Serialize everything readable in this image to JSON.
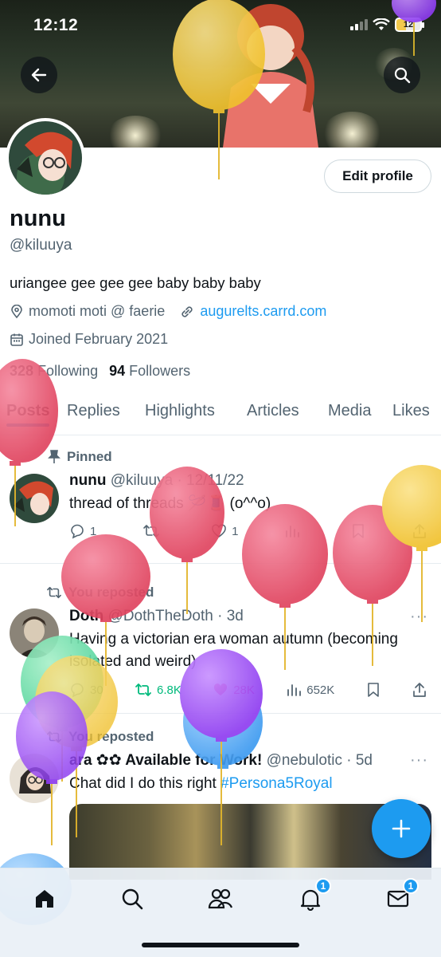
{
  "status_bar": {
    "time": "12:12",
    "battery": "12"
  },
  "profile": {
    "display_name": "nunu",
    "handle": "@kiluuya",
    "bio": "uriangee gee gee gee baby baby baby",
    "location": "momoti moti @ faerie",
    "website": "augurelts.carrd.com",
    "joined": "Joined February 2021",
    "following_count": "328",
    "following_label": "Following",
    "followers_count": "94",
    "followers_label": "Followers",
    "edit_profile_label": "Edit profile"
  },
  "tabs": [
    {
      "label": "Posts",
      "active": true
    },
    {
      "label": "Replies"
    },
    {
      "label": "Highlights"
    },
    {
      "label": "Articles"
    },
    {
      "label": "Media"
    },
    {
      "label": "Likes"
    }
  ],
  "posts": [
    {
      "context": "Pinned",
      "author": "nunu",
      "handle": "@kiluuya",
      "separator": "·",
      "time": "12/11/22",
      "text": "thread of threads 🪡🧵 (o^^o)",
      "replies": "1",
      "retweets": "",
      "likes": "1",
      "views": ""
    },
    {
      "context": "You reposted",
      "author": "Doth",
      "handle": "@DothTheDoth",
      "separator": "·",
      "time": "3d",
      "text": "Having a victorian era woman autumn (becoming isolated and weird)",
      "replies": "30",
      "retweets": "6.8K",
      "likes": "28K",
      "views": "652K"
    },
    {
      "context": "You reposted",
      "author": "ara ✿✿ Available for Work!",
      "handle": "@nebulotic",
      "separator": "·",
      "time": "5d",
      "text": "Chat did I do this right",
      "hashtag": "#Persona5Royal"
    }
  ],
  "nav": {
    "notifications_badge": "1",
    "messages_badge": "1"
  },
  "icons": [
    "back-arrow-icon",
    "search-icon",
    "location-pin-icon",
    "link-icon",
    "calendar-icon",
    "pin-icon",
    "retweet-icon",
    "reply-icon",
    "like-icon",
    "views-icon",
    "bookmark-icon",
    "share-icon",
    "plus-icon",
    "home-icon",
    "people-icon",
    "bell-icon",
    "mail-icon"
  ],
  "colors": {
    "accent": "#1d9bf0",
    "text": "#0f1419",
    "muted": "#536471",
    "retweet": "#00ba7c",
    "like": "#f91880"
  }
}
